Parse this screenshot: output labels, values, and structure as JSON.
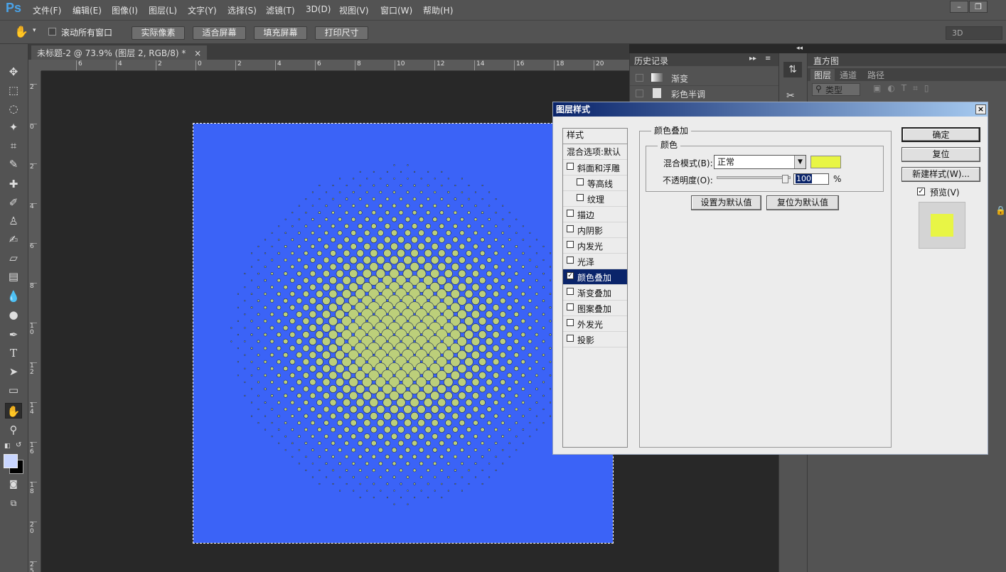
{
  "app": {
    "logo": "Ps"
  },
  "menu": [
    "文件(F)",
    "编辑(E)",
    "图像(I)",
    "图层(L)",
    "文字(Y)",
    "选择(S)",
    "滤镜(T)",
    "3D(D)",
    "视图(V)",
    "窗口(W)",
    "帮助(H)"
  ],
  "window_controls": {
    "minimize": "–",
    "restore": "❐"
  },
  "options": {
    "scroll_all": "滚动所有窗口",
    "actual_pixels": "实际像素",
    "fit_screen": "适合屏幕",
    "fill_screen": "填充屏幕",
    "print_size": "打印尺寸",
    "workspace": "3D"
  },
  "document": {
    "tab_title": "未标题-2 @ 73.9% (图层 2, RGB/8) *",
    "close": "×"
  },
  "ruler": {
    "h_ticks": [
      "6",
      "4",
      "2",
      "0",
      "2",
      "4",
      "6",
      "8",
      "10",
      "12",
      "14",
      "16",
      "18",
      "20"
    ],
    "v_ticks": [
      "2",
      "0",
      "2",
      "4",
      "6",
      "8",
      "1\n0",
      "1\n2",
      "1\n4",
      "1\n6",
      "1\n8",
      "2\n0",
      "2\n5"
    ]
  },
  "history": {
    "title": "历史记录",
    "items": [
      "渐变",
      "彩色半调"
    ]
  },
  "right_panel": {
    "histogram": "直方图",
    "tabs": [
      "图层",
      "通道",
      "路径"
    ],
    "filter": "类型"
  },
  "dialog": {
    "title": "图层样式",
    "close": "×",
    "styles_header": "样式",
    "blend_options": "混合选项:默认",
    "style_items": [
      {
        "label": "斜面和浮雕",
        "checked": false,
        "indent": false
      },
      {
        "label": "等高线",
        "checked": false,
        "indent": true
      },
      {
        "label": "纹理",
        "checked": false,
        "indent": true
      },
      {
        "label": "描边",
        "checked": false,
        "indent": false
      },
      {
        "label": "内阴影",
        "checked": false,
        "indent": false
      },
      {
        "label": "内发光",
        "checked": false,
        "indent": false
      },
      {
        "label": "光泽",
        "checked": false,
        "indent": false
      },
      {
        "label": "颜色叠加",
        "checked": true,
        "indent": false,
        "selected": true
      },
      {
        "label": "渐变叠加",
        "checked": false,
        "indent": false
      },
      {
        "label": "图案叠加",
        "checked": false,
        "indent": false
      },
      {
        "label": "外发光",
        "checked": false,
        "indent": false
      },
      {
        "label": "投影",
        "checked": false,
        "indent": false
      }
    ],
    "group_title": "颜色叠加",
    "subgroup_title": "颜色",
    "blend_mode_label": "混合模式(B):",
    "blend_mode_value": "正常",
    "overlay_color": "#e8f545",
    "opacity_label": "不透明度(O):",
    "opacity_value": "100",
    "opacity_unit": "%",
    "set_default": "设置为默认值",
    "reset_default": "复位为默认值",
    "ok": "确定",
    "reset": "复位",
    "new_style": "新建样式(W)...",
    "preview_label": "预览(V)",
    "preview_checked": true
  },
  "colors": {
    "canvas_blue": "#3b63f7",
    "dot_green": "#bccf7a",
    "accent_title": "#0a246a"
  }
}
